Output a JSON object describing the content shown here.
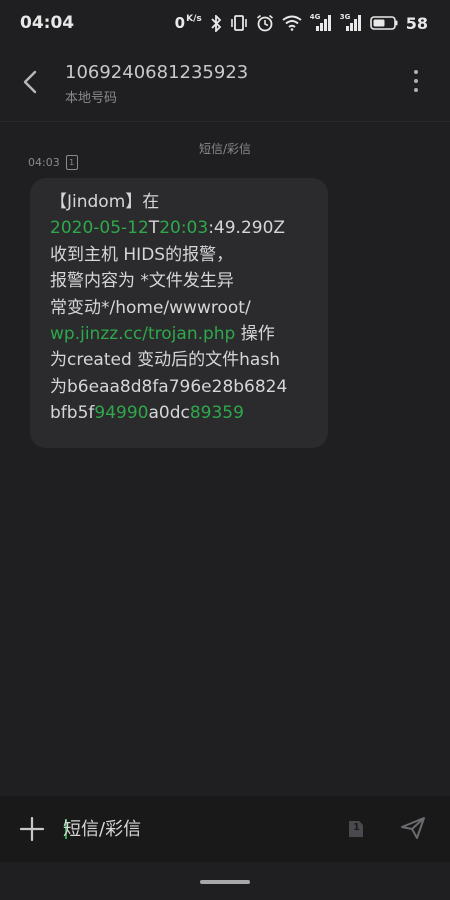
{
  "status_bar": {
    "time": "04:04",
    "net_speed_value": "0",
    "net_speed_unit": "K/s",
    "network_1": "4G",
    "network_2": "3G",
    "battery_level": "58"
  },
  "header": {
    "contact_number": "1069240681235923",
    "contact_subtitle": "本地号码"
  },
  "thread": {
    "message_type": "短信/彩信",
    "message_time": "04:03",
    "sim_slot": "1",
    "highlight_color": "#2ea84a",
    "message_lines": {
      "l1": "【Jindom】在",
      "l2_date": "2020-05-12",
      "l2_t": "T",
      "l2_time": "20:03",
      "l2_rest": ":49.290Z",
      "l3": "收到主机  HIDS的报警，",
      "l4": "报警内容为 *文件发生异",
      "l5": "常变动*/home/wwwroot/",
      "l6_link": "wp.jinzz.cc/trojan.php",
      "l6_rest": " 操作",
      "l7": "为created 变动后的文件hash",
      "l8": "为b6eaa8d8fa796e28b6824",
      "l9_a": "bfb5f",
      "l9_b": "94990",
      "l9_c": "a0dc",
      "l9_d": "89359"
    }
  },
  "composer": {
    "placeholder": "短信/彩信",
    "sim_slot": "1"
  }
}
